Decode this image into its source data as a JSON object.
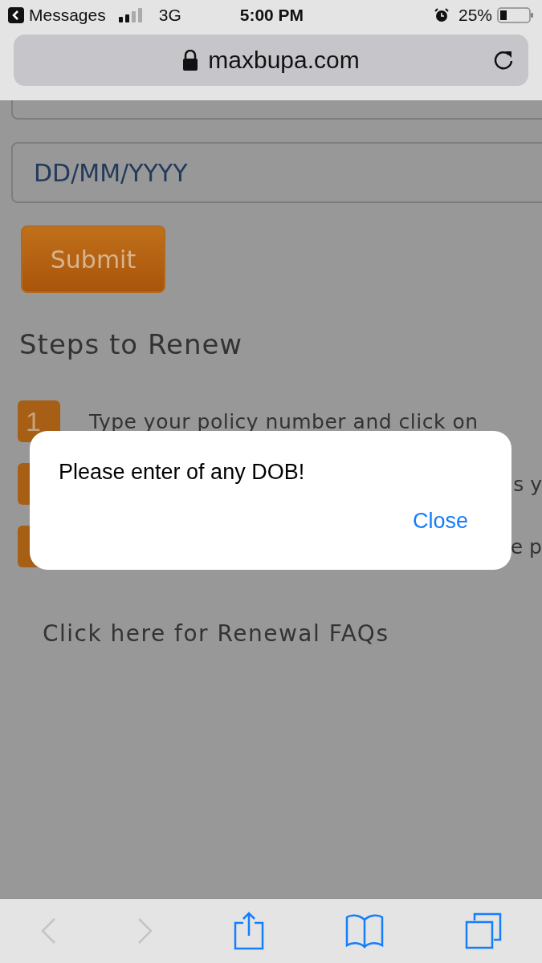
{
  "status_bar": {
    "back_app": "Messages",
    "network": "3G",
    "time": "5:00 PM",
    "battery": "25%"
  },
  "address_bar": {
    "url": "maxbupa.com"
  },
  "form": {
    "dob_field": {
      "placeholder": "DD/MM/YYYY"
    },
    "submit": "Submit"
  },
  "steps_section": {
    "title": "Steps to Renew",
    "steps": [
      {
        "number": "1",
        "text": "Type your policy number and click on"
      },
      {
        "text": "s y"
      },
      {
        "text": "e p"
      }
    ],
    "faq_link": "Click here for Renewal FAQs"
  },
  "alert": {
    "message": "Please enter of any DOB!",
    "button": "Close"
  },
  "toolbar": {
    "back": {
      "disabled": true
    },
    "forward": {
      "disabled": true
    }
  }
}
